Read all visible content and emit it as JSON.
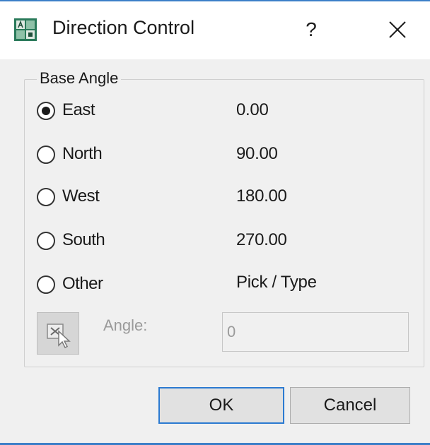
{
  "window": {
    "title": "Direction Control",
    "help_label": "?",
    "close_label": "✕",
    "icon": "app-icon"
  },
  "group": {
    "label": "Base Angle",
    "options": [
      {
        "label": "East",
        "value": "0.00",
        "checked": true
      },
      {
        "label": "North",
        "value": "90.00",
        "checked": false
      },
      {
        "label": "West",
        "value": "180.00",
        "checked": false
      },
      {
        "label": "South",
        "value": "270.00",
        "checked": false
      },
      {
        "label": "Other",
        "value": "Pick / Type",
        "checked": false
      }
    ],
    "pick_button_icon": "pick-angle-icon",
    "angle_label": "Angle:",
    "angle_value": "0"
  },
  "buttons": {
    "ok_label": "OK",
    "cancel_label": "Cancel"
  },
  "colors": {
    "accent": "#3c7fc8",
    "dialog_bg": "#f0f0f0"
  }
}
